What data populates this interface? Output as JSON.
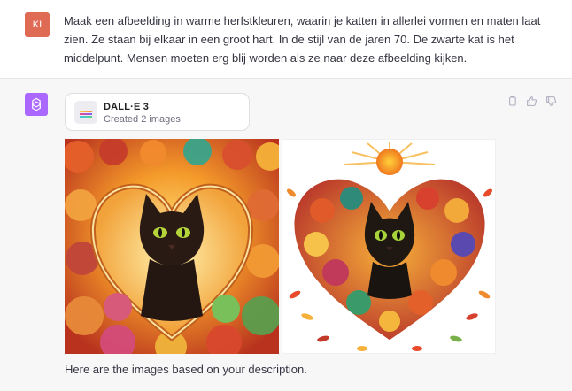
{
  "user": {
    "avatar_initials": "KI",
    "avatar_color": "#df6b55",
    "message": "Maak een afbeelding in warme herfstkleuren, waarin je katten in allerlei vormen en maten laat zien. Ze staan bij elkaar in een groot hart. In de stijl van de jaren 70. De zwarte kat is het middelpunt. Mensen moeten erg blij worden als ze naar deze afbeelding kijken."
  },
  "assistant": {
    "avatar_color": "#ab68ff",
    "tool": {
      "name": "DALL·E 3",
      "status": "Created 2 images"
    },
    "actions": [
      "copy-icon",
      "thumbs-up-icon",
      "thumbs-down-icon"
    ],
    "images": [
      {
        "name": "generated-image-1",
        "icon": "cat-heart-image"
      },
      {
        "name": "generated-image-2",
        "icon": "cat-heart-image"
      }
    ],
    "reply": "Here are the images based on your description."
  }
}
